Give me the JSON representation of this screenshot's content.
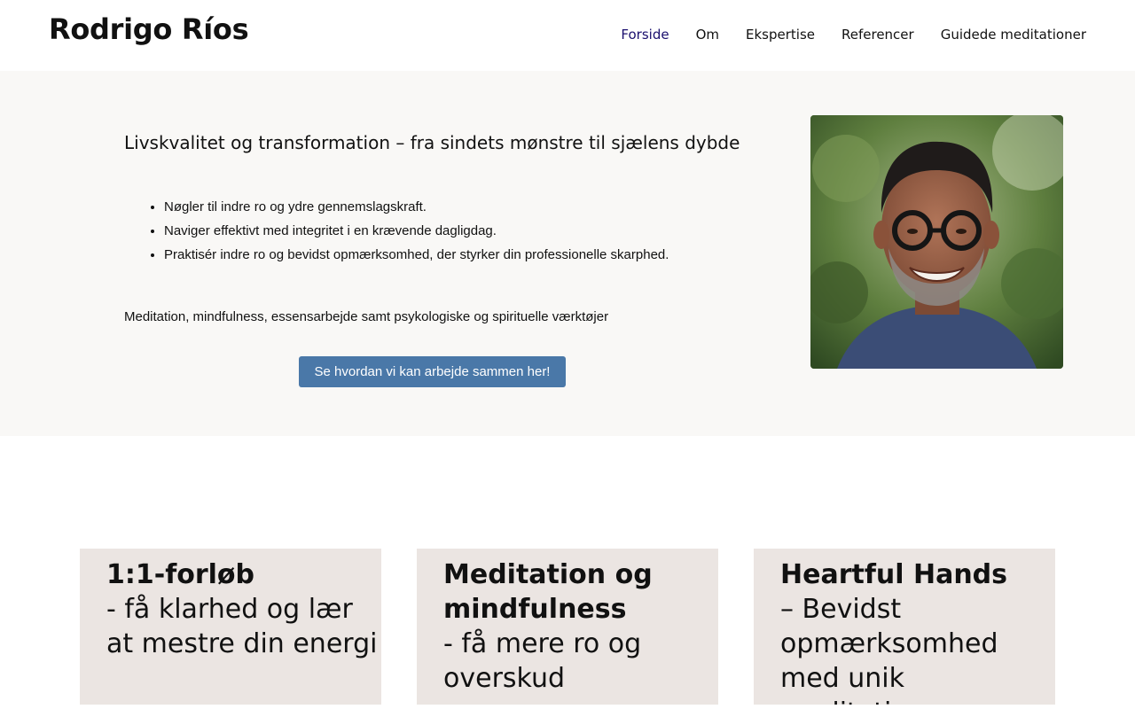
{
  "site": {
    "title": "Rodrigo Ríos"
  },
  "nav": {
    "items": [
      {
        "label": "Forside",
        "active": true
      },
      {
        "label": "Om",
        "active": false
      },
      {
        "label": "Ekspertise",
        "active": false
      },
      {
        "label": "Referencer",
        "active": false
      },
      {
        "label": "Guidede meditationer",
        "active": false
      }
    ]
  },
  "hero": {
    "heading": "Livskvalitet og transformation – fra sindets mønstre til sjælens dybde",
    "bullets": [
      "Nøgler til indre ro og ydre gennemslagskraft.",
      "Naviger effektivt med integritet i en krævende dagligdag.",
      "Praktisér indre ro og bevidst opmærksomhed, der styrker din professionelle skarphed."
    ],
    "subtext": "Meditation, mindfulness, essensarbejde samt psykologiske og spirituelle værktøjer",
    "cta_label": "Se hvordan vi kan arbejde sammen her!"
  },
  "cards": [
    {
      "title": "1:1-forløb",
      "subtitle": "- få klarhed og lær at mestre din energi"
    },
    {
      "title": "Meditation og mindfulness",
      "subtitle": "- få mere ro og overskud"
    },
    {
      "title": "Heartful Hands",
      "subtitle": "– Bevidst opmærksomhed med unik meditation"
    }
  ],
  "colors": {
    "nav_active": "#1a0f6e",
    "hero_background": "#f9f8f6",
    "cta_background": "#4a78a8",
    "card_background": "#ebe5e2"
  }
}
